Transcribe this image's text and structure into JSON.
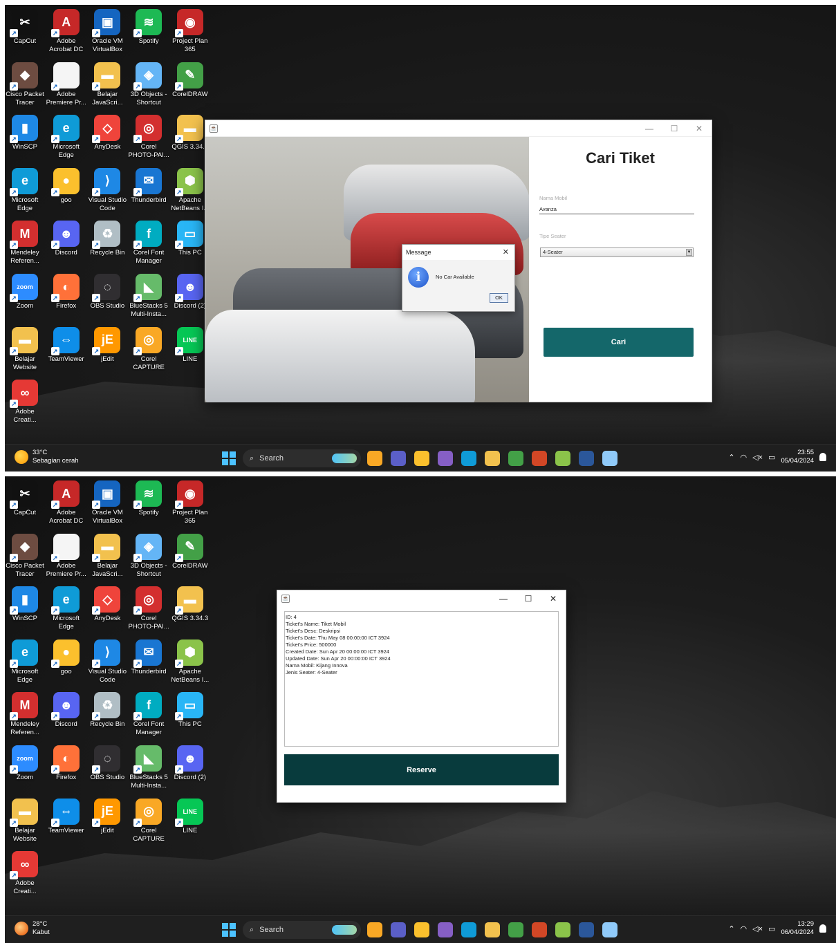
{
  "desktop": {
    "icons": [
      {
        "label": "CapCut",
        "icon": "capcut-icon",
        "color": "#111111",
        "glyph": "✂"
      },
      {
        "label": "Adobe\nAcrobat DC",
        "icon": "acrobat-icon",
        "color": "#c62828",
        "glyph": "A"
      },
      {
        "label": "Oracle VM\nVirtualBox",
        "icon": "virtualbox-icon",
        "color": "#1565c0",
        "glyph": "▣"
      },
      {
        "label": "Spotify",
        "icon": "spotify-icon",
        "color": "#1db954",
        "glyph": "≋"
      },
      {
        "label": "Project Plan\n365",
        "icon": "project-plan-icon",
        "color": "#c62828",
        "glyph": "◉"
      },
      {
        "label": "Cisco Packet\nTracer",
        "icon": "cisco-icon",
        "color": "#6d4c41",
        "glyph": "◆"
      },
      {
        "label": "Adobe\nPremiere Pr...",
        "icon": "file-icon",
        "color": "#f5f5f5",
        "glyph": ""
      },
      {
        "label": "Belajar\nJavaScri...",
        "icon": "folder-icon",
        "color": "#f2c14e",
        "glyph": "▬"
      },
      {
        "label": "3D Objects -\nShortcut",
        "icon": "3d-objects-icon",
        "color": "#64b5f6",
        "glyph": "◈"
      },
      {
        "label": "CorelDRAW",
        "icon": "coreldraw-icon",
        "color": "#43a047",
        "glyph": "✎"
      },
      {
        "label": "WinSCP",
        "icon": "winscp-icon",
        "color": "#1e88e5",
        "glyph": "▮"
      },
      {
        "label": "Microsoft\nEdge",
        "icon": "edge-icon",
        "color": "#0f9bd7",
        "glyph": "e"
      },
      {
        "label": "AnyDesk",
        "icon": "anydesk-icon",
        "color": "#ef443b",
        "glyph": "◇"
      },
      {
        "label": "Corel\nPHOTO-PAI...",
        "icon": "photopaint-icon",
        "color": "#d32f2f",
        "glyph": "◎"
      },
      {
        "label": "QGIS 3.34.3",
        "icon": "folder-icon",
        "color": "#f2c14e",
        "glyph": "▬"
      },
      {
        "label": "Microsoft\nEdge",
        "icon": "edge-icon",
        "color": "#0f9bd7",
        "glyph": "e"
      },
      {
        "label": "goo",
        "icon": "chrome-icon",
        "color": "#fbc02d",
        "glyph": "●"
      },
      {
        "label": "Visual Studio\nCode",
        "icon": "vscode-icon",
        "color": "#1e88e5",
        "glyph": "⟩"
      },
      {
        "label": "Thunderbird",
        "icon": "thunderbird-icon",
        "color": "#1976d2",
        "glyph": "✉"
      },
      {
        "label": "Apache\nNetBeans I...",
        "icon": "netbeans-icon",
        "color": "#8bc34a",
        "glyph": "⬢"
      },
      {
        "label": "Mendeley\nReferen...",
        "icon": "mendeley-icon",
        "color": "#d32f2f",
        "glyph": "M"
      },
      {
        "label": "Discord",
        "icon": "discord-icon",
        "color": "#5865f2",
        "glyph": "☻"
      },
      {
        "label": "Recycle Bin",
        "icon": "recycle-bin-icon",
        "color": "#b0bec5",
        "glyph": "♻"
      },
      {
        "label": "Corel Font\nManager",
        "icon": "corel-font-icon",
        "color": "#00acc1",
        "glyph": "f"
      },
      {
        "label": "This PC",
        "icon": "this-pc-icon",
        "color": "#29b6f6",
        "glyph": "▭"
      },
      {
        "label": "Zoom",
        "icon": "zoom-icon",
        "color": "#2d8cff",
        "glyph": "zoom"
      },
      {
        "label": "Firefox",
        "icon": "firefox-icon",
        "color": "#ff7139",
        "glyph": "◐"
      },
      {
        "label": "OBS Studio",
        "icon": "obs-icon",
        "color": "#302e31",
        "glyph": "◌"
      },
      {
        "label": "BlueStacks 5\nMulti-Insta...",
        "icon": "bluestacks-icon",
        "color": "#66bb6a",
        "glyph": "◣"
      },
      {
        "label": "Discord (2)",
        "icon": "discord-icon",
        "color": "#5865f2",
        "glyph": "☻"
      },
      {
        "label": "Belajar\nWebsite",
        "icon": "folder-icon",
        "color": "#f2c14e",
        "glyph": "▬"
      },
      {
        "label": "TeamViewer",
        "icon": "teamviewer-icon",
        "color": "#0e8ee9",
        "glyph": "⇔"
      },
      {
        "label": "jEdit",
        "icon": "jedit-icon",
        "color": "#ff9800",
        "glyph": "jE"
      },
      {
        "label": "Corel\nCAPTURE",
        "icon": "corel-capture-icon",
        "color": "#f9a825",
        "glyph": "◎"
      },
      {
        "label": "LINE",
        "icon": "line-icon",
        "color": "#06c755",
        "glyph": "LINE"
      },
      {
        "label": "Adobe\nCreati...",
        "icon": "creative-cloud-icon",
        "color": "#e53935",
        "glyph": "∞"
      }
    ]
  },
  "screen1": {
    "weather": {
      "temp": "33°C",
      "desc": "Sebagian cerah"
    },
    "search_label": "Search",
    "clock": {
      "time": "23:55",
      "date": "05/04/2024"
    },
    "window": {
      "title_minimize": "—",
      "title_maximize": "☐",
      "title_close": "✕",
      "form_title": "Cari Tiket",
      "nama_mobil_label": "Nama Mobil",
      "nama_mobil_value": "Avanza",
      "tipe_seater_label": "Tipe Seater",
      "tipe_seater_value": "4-Seater",
      "cari_button": "Cari"
    },
    "dialog": {
      "title": "Message",
      "message": "No Car Available",
      "ok": "OK"
    }
  },
  "screen2": {
    "weather": {
      "temp": "28°C",
      "desc": "Kabut"
    },
    "search_label": "Search",
    "clock": {
      "time": "13:29",
      "date": "06/04/2024"
    },
    "window": {
      "ticket_lines": [
        "ID: 4",
        "Ticket's Name: Tiket Mobil",
        "Ticket's Desc: Deskripsi",
        "Ticket's Date: Thu May 08 00:00:00 ICT 3924",
        "Ticket's Price: 500000",
        "Created Date: Sun Apr 20 00:00:00 ICT 3924",
        "Updated Date: Sun Apr 20 00:00:00 ICT 3924",
        "Nama Mobil: Kijang Innova",
        "Jenis Seater: 4-Seater"
      ],
      "reserve_button": "Reserve"
    }
  },
  "taskbar_apps": [
    {
      "icon": "widgets-icon",
      "color": "#f9a825"
    },
    {
      "icon": "teams-icon",
      "color": "#5b5fc7"
    },
    {
      "icon": "chrome-icon",
      "color": "#fbc02d"
    },
    {
      "icon": "visual-studio-icon",
      "color": "#865fc5"
    },
    {
      "icon": "edge-icon",
      "color": "#0f9bd7"
    },
    {
      "icon": "file-explorer-icon",
      "color": "#f2c14e"
    },
    {
      "icon": "chrome-canary-icon",
      "color": "#43a047"
    },
    {
      "icon": "powerpoint-icon",
      "color": "#d24726"
    },
    {
      "icon": "netbeans-icon",
      "color": "#8bc34a"
    },
    {
      "icon": "word-icon",
      "color": "#2b579a"
    },
    {
      "icon": "java-app-icon",
      "color": "#90caf9"
    }
  ]
}
